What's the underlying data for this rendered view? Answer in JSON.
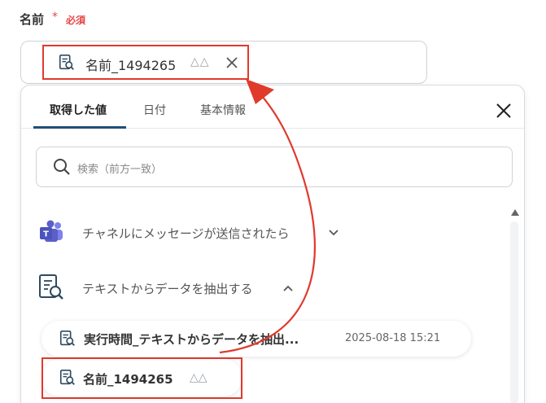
{
  "field": {
    "label": "名前",
    "required_mark": "*",
    "required_text": "必須"
  },
  "chip": {
    "label": "名前_1494265",
    "symbols": "△△",
    "icon": "document-search-icon",
    "close_icon": "close-icon"
  },
  "tabs": [
    {
      "label": "取得した値",
      "active": true
    },
    {
      "label": "日付",
      "active": false
    },
    {
      "label": "基本情報",
      "active": false
    }
  ],
  "search": {
    "placeholder": "検索（前方一致）"
  },
  "groups": [
    {
      "label": "チャネルにメッセージが送信されたら",
      "icon": "microsoft-teams-icon",
      "expanded": false
    },
    {
      "label": "テキストからデータを抽出する",
      "icon": "document-search-icon",
      "expanded": true
    }
  ],
  "results": [
    {
      "label": "実行時間_テキストからデータを抽出...",
      "meta": "2025-08-18 15:21"
    },
    {
      "label": "名前_1494265",
      "meta": "△△"
    }
  ],
  "colors": {
    "accent_red": "#e03a2d",
    "tab_underline": "#1f4f73",
    "teams_purple": "#5b5fc7"
  }
}
